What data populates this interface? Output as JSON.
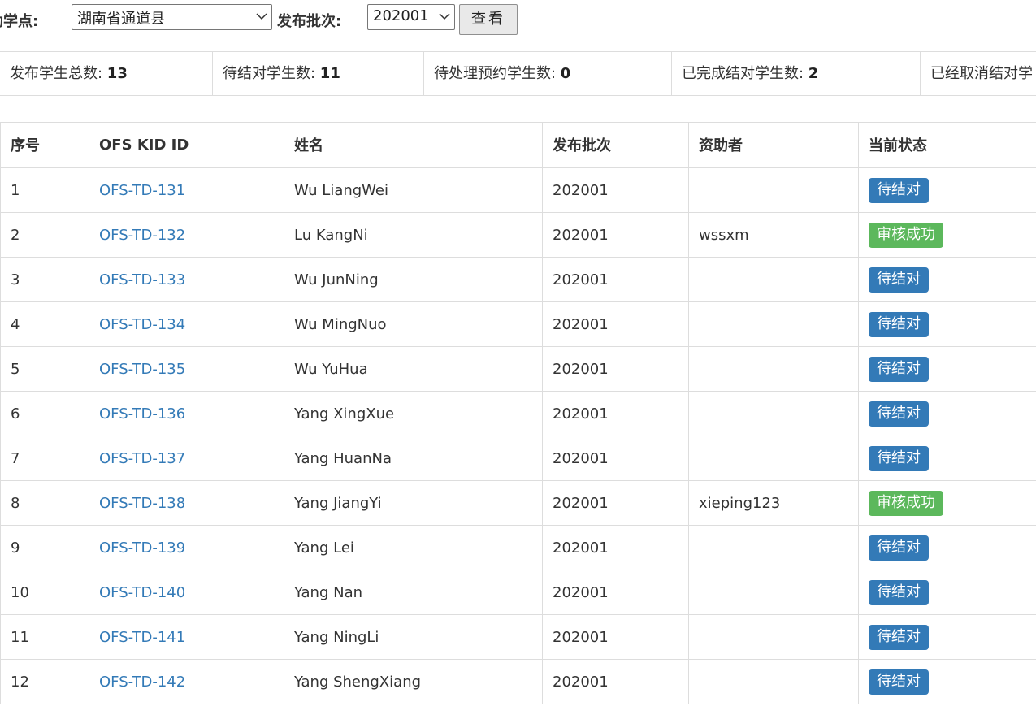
{
  "filters": {
    "site_label": "助学点:",
    "site_value": "湖南省通道县",
    "batch_label": "发布批次:",
    "batch_value": "202001",
    "view_button": "查看"
  },
  "stats": [
    {
      "label": "发布学生总数: ",
      "value": "13"
    },
    {
      "label": "待结对学生数: ",
      "value": "11"
    },
    {
      "label": "待处理预约学生数: ",
      "value": "0"
    },
    {
      "label": "已完成结对学生数: ",
      "value": "2"
    },
    {
      "label": "已经取消结对学",
      "value": ""
    }
  ],
  "table": {
    "headers": [
      "序号",
      "OFS KID ID",
      "姓名",
      "发布批次",
      "资助者",
      "当前状态"
    ],
    "rows": [
      {
        "no": "1",
        "kid_id": "OFS-TD-131",
        "name": "Wu LiangWei",
        "batch": "202001",
        "sponsor": "",
        "status": "待结对",
        "status_color": "#337ab7"
      },
      {
        "no": "2",
        "kid_id": "OFS-TD-132",
        "name": "Lu KangNi",
        "batch": "202001",
        "sponsor": "wssxm",
        "status": "审核成功",
        "status_color": "#5cb85c"
      },
      {
        "no": "3",
        "kid_id": "OFS-TD-133",
        "name": "Wu JunNing",
        "batch": "202001",
        "sponsor": "",
        "status": "待结对",
        "status_color": "#337ab7"
      },
      {
        "no": "4",
        "kid_id": "OFS-TD-134",
        "name": "Wu MingNuo",
        "batch": "202001",
        "sponsor": "",
        "status": "待结对",
        "status_color": "#337ab7"
      },
      {
        "no": "5",
        "kid_id": "OFS-TD-135",
        "name": "Wu YuHua",
        "batch": "202001",
        "sponsor": "",
        "status": "待结对",
        "status_color": "#337ab7"
      },
      {
        "no": "6",
        "kid_id": "OFS-TD-136",
        "name": "Yang XingXue",
        "batch": "202001",
        "sponsor": "",
        "status": "待结对",
        "status_color": "#337ab7"
      },
      {
        "no": "7",
        "kid_id": "OFS-TD-137",
        "name": "Yang HuanNa",
        "batch": "202001",
        "sponsor": "",
        "status": "待结对",
        "status_color": "#337ab7"
      },
      {
        "no": "8",
        "kid_id": "OFS-TD-138",
        "name": "Yang JiangYi",
        "batch": "202001",
        "sponsor": "xieping123",
        "status": "审核成功",
        "status_color": "#5cb85c"
      },
      {
        "no": "9",
        "kid_id": "OFS-TD-139",
        "name": "Yang Lei",
        "batch": "202001",
        "sponsor": "",
        "status": "待结对",
        "status_color": "#337ab7"
      },
      {
        "no": "10",
        "kid_id": "OFS-TD-140",
        "name": "Yang Nan",
        "batch": "202001",
        "sponsor": "",
        "status": "待结对",
        "status_color": "#337ab7"
      },
      {
        "no": "11",
        "kid_id": "OFS-TD-141",
        "name": "Yang NingLi",
        "batch": "202001",
        "sponsor": "",
        "status": "待结对",
        "status_color": "#337ab7"
      },
      {
        "no": "12",
        "kid_id": "OFS-TD-142",
        "name": "Yang ShengXiang",
        "batch": "202001",
        "sponsor": "",
        "status": "待结对",
        "status_color": "#337ab7"
      }
    ]
  }
}
